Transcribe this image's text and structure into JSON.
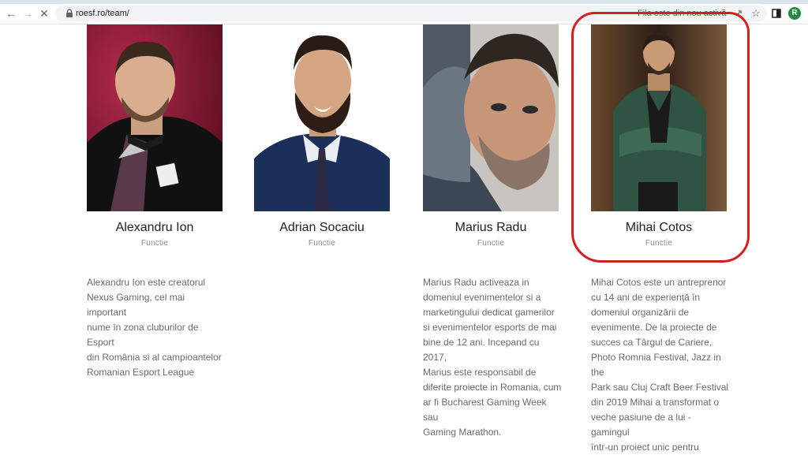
{
  "browser": {
    "url": "roesf.ro/team/",
    "notice": "Fila este din nou activă",
    "profile_initial": "R"
  },
  "team": [
    {
      "name": "Alexandru Ion",
      "role": "Functie",
      "bio": "Alexandru Ion este creatorul\nNexus Gaming, cel mai important\nnume în zona cluburilor de Esport\ndin România si al campioantelor\nRomanian Esport League"
    },
    {
      "name": "Adrian Socaciu",
      "role": "Functie",
      "bio": ""
    },
    {
      "name": "Marius Radu",
      "role": "Functie",
      "bio": "Marius Radu activeaza in\ndomeniul evenimentelor si a\nmarketingului dedicat gamerilor\nsi evenimentelor esports de mai\nbine de 12 ani. Incepand cu 2017,\nMarius este responsabil de\ndiferite proiecte in Romania, cum\nar fi Bucharest Gaming Week sau\nGaming Marathon."
    },
    {
      "name": "Mihai Cotos",
      "role": "Functie",
      "bio": "Mihai Cotos este un antreprenor\ncu 14 ani de experiență în\ndomeniul organizării de\nevenimente. De la proiecte de\nsucces ca Târgul de Cariere,\nPhoto Romnia Festival, Jazz in the\nPark sau Cluj Craft Beer Festival\ndin 2019 Mihai a transformat o\nveche pasiune de a lui - gamingul\nîntr-un proiect unic pentru"
    }
  ],
  "colors": {
    "highlight": "#d41f1f",
    "name_text": "#1f1f1f",
    "role_text": "#8a8a8a",
    "bio_text": "#6b6b6b"
  },
  "icons": [
    "back-icon",
    "forward-icon",
    "stop-loading-icon",
    "lock-icon",
    "share-icon",
    "star-icon",
    "sidebar-icon"
  ]
}
